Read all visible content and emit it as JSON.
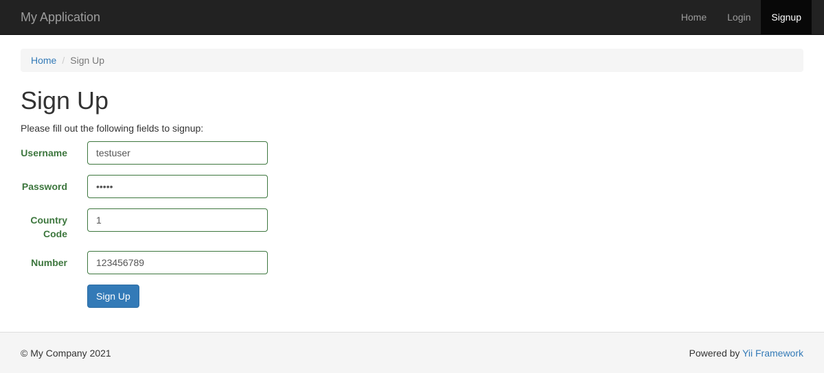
{
  "navbar": {
    "brand": "My Application",
    "items": [
      {
        "label": "Home",
        "active": false
      },
      {
        "label": "Login",
        "active": false
      },
      {
        "label": "Signup",
        "active": true
      }
    ]
  },
  "breadcrumb": {
    "home": "Home",
    "separator": "/",
    "current": "Sign Up"
  },
  "page": {
    "title": "Sign Up",
    "intro": "Please fill out the following fields to signup:"
  },
  "form": {
    "username": {
      "label": "Username",
      "value": "testuser"
    },
    "password": {
      "label": "Password",
      "value": "•••••"
    },
    "country_code": {
      "label": "Country Code",
      "value": "1"
    },
    "number": {
      "label": "Number",
      "value": "123456789"
    },
    "submit_label": "Sign Up"
  },
  "footer": {
    "copyright": "© My Company 2021",
    "powered_by": "Powered by",
    "framework_link": "Yii Framework"
  },
  "colors": {
    "navbar_bg": "#222222",
    "accent": "#337ab7",
    "success": "#3c763d"
  }
}
